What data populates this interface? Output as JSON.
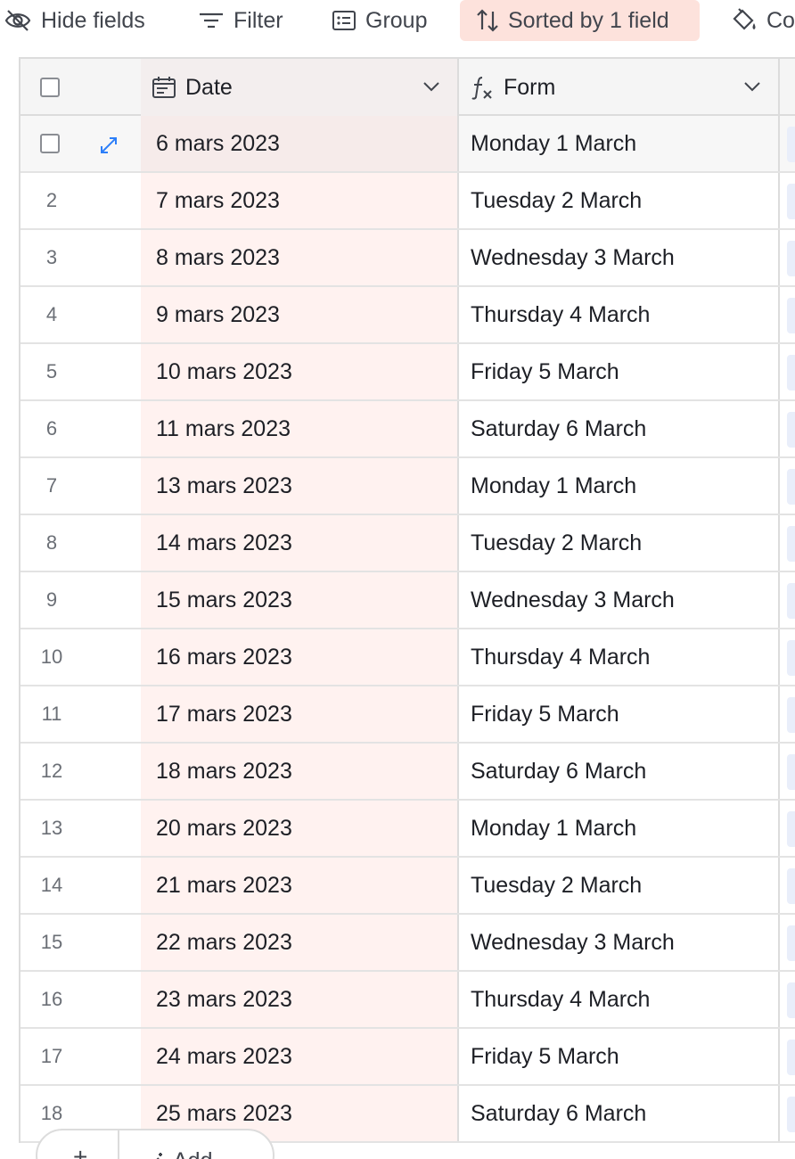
{
  "toolbar": {
    "hide_fields": "Hide fields",
    "filter": "Filter",
    "group": "Group",
    "sort": "Sorted by 1 field",
    "color": "Co",
    "sort_bg": "#fde2dc"
  },
  "columns": {
    "date": {
      "label": "Date",
      "icon": "calendar-icon"
    },
    "form": {
      "label": "Form",
      "icon": "formula-icon"
    }
  },
  "rows": [
    {
      "num": "",
      "date": "6 mars 2023",
      "form": "Monday 1 March"
    },
    {
      "num": "2",
      "date": "7 mars 2023",
      "form": "Tuesday 2 March"
    },
    {
      "num": "3",
      "date": "8 mars 2023",
      "form": "Wednesday 3 March"
    },
    {
      "num": "4",
      "date": "9 mars 2023",
      "form": "Thursday 4 March"
    },
    {
      "num": "5",
      "date": "10 mars 2023",
      "form": "Friday 5 March"
    },
    {
      "num": "6",
      "date": "11 mars 2023",
      "form": "Saturday 6 March"
    },
    {
      "num": "7",
      "date": "13 mars 2023",
      "form": "Monday 1 March"
    },
    {
      "num": "8",
      "date": "14 mars 2023",
      "form": "Tuesday 2 March"
    },
    {
      "num": "9",
      "date": "15 mars 2023",
      "form": "Wednesday 3 March"
    },
    {
      "num": "10",
      "date": "16 mars 2023",
      "form": "Thursday 4 March"
    },
    {
      "num": "11",
      "date": "17 mars 2023",
      "form": "Friday 5 March"
    },
    {
      "num": "12",
      "date": "18 mars 2023",
      "form": "Saturday 6 March"
    },
    {
      "num": "13",
      "date": "20 mars 2023",
      "form": "Monday 1 March"
    },
    {
      "num": "14",
      "date": "21 mars 2023",
      "form": "Tuesday 2 March"
    },
    {
      "num": "15",
      "date": "22 mars 2023",
      "form": "Wednesday 3 March"
    },
    {
      "num": "16",
      "date": "23 mars 2023",
      "form": "Thursday 4 March"
    },
    {
      "num": "17",
      "date": "24 mars 2023",
      "form": "Friday 5 March"
    },
    {
      "num": "18",
      "date": "25 mars 2023",
      "form": "Saturday 6 March"
    }
  ],
  "footer": {
    "plus": "+",
    "add_label": "Add..."
  },
  "colors": {
    "date_column_tint": "#fff2f0",
    "accent_blue": "#2d7ff9"
  }
}
